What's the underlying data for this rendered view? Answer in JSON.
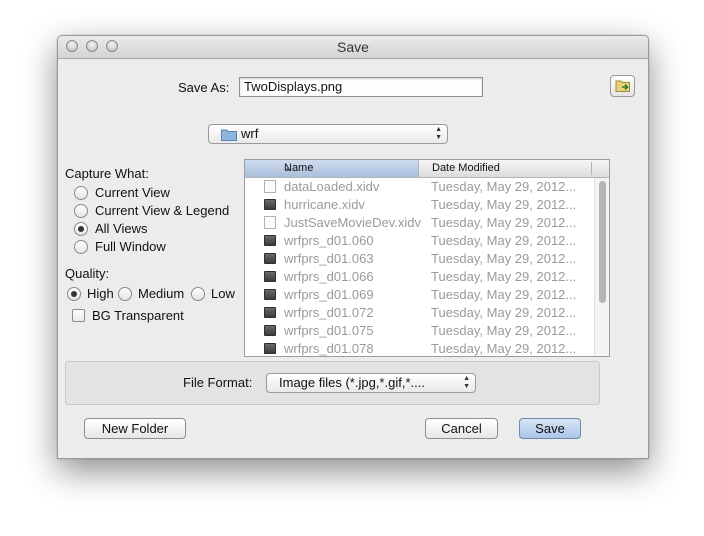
{
  "window": {
    "title": "Save"
  },
  "save_as": {
    "label": "Save As:",
    "value": "TwoDisplays.png"
  },
  "location": {
    "folder": "wrf"
  },
  "capture": {
    "label": "Capture What:",
    "options": [
      {
        "label": "Current View",
        "selected": false
      },
      {
        "label": "Current View & Legend",
        "selected": false
      },
      {
        "label": "All Views",
        "selected": true
      },
      {
        "label": "Full Window",
        "selected": false
      }
    ]
  },
  "quality": {
    "label": "Quality:",
    "options": [
      {
        "label": "High",
        "selected": true
      },
      {
        "label": "Medium",
        "selected": false
      },
      {
        "label": "Low",
        "selected": false
      }
    ]
  },
  "bg_transparent": {
    "label": "BG Transparent",
    "checked": false
  },
  "file_list": {
    "columns": {
      "name": "Name",
      "date": "Date Modified"
    },
    "rows": [
      {
        "name": "dataLoaded.xidv",
        "date": "Tuesday, May 29, 2012...",
        "icon": "document-icon"
      },
      {
        "name": "hurricane.xidv",
        "date": "Tuesday, May 29, 2012...",
        "icon": "data-file-icon"
      },
      {
        "name": "JustSaveMovieDev.xidv",
        "date": "Tuesday, May 29, 2012...",
        "icon": "document-icon"
      },
      {
        "name": "wrfprs_d01.060",
        "date": "Tuesday, May 29, 2012...",
        "icon": "data-file-icon"
      },
      {
        "name": "wrfprs_d01.063",
        "date": "Tuesday, May 29, 2012...",
        "icon": "data-file-icon"
      },
      {
        "name": "wrfprs_d01.066",
        "date": "Tuesday, May 29, 2012...",
        "icon": "data-file-icon"
      },
      {
        "name": "wrfprs_d01.069",
        "date": "Tuesday, May 29, 2012...",
        "icon": "data-file-icon"
      },
      {
        "name": "wrfprs_d01.072",
        "date": "Tuesday, May 29, 2012...",
        "icon": "data-file-icon"
      },
      {
        "name": "wrfprs_d01.075",
        "date": "Tuesday, May 29, 2012...",
        "icon": "data-file-icon"
      },
      {
        "name": "wrfprs_d01.078",
        "date": "Tuesday, May 29, 2012...",
        "icon": "data-file-icon"
      }
    ]
  },
  "file_format": {
    "label": "File Format:",
    "value": "Image files (*.jpg,*.gif,*...."
  },
  "buttons": {
    "new_folder": "New Folder",
    "cancel": "Cancel",
    "save": "Save"
  }
}
